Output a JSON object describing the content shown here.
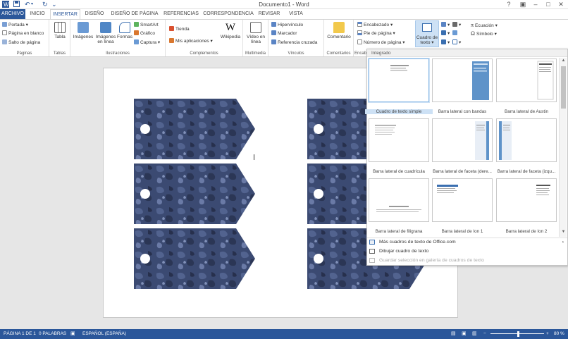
{
  "window": {
    "title": "Documento1 - Word",
    "minimize": "–",
    "maximize": "□",
    "close": "✕",
    "help": "?",
    "ribbon_opts": "▣"
  },
  "qat": {
    "undo": "↶",
    "redo": "↻",
    "more": "⌄"
  },
  "tabs": [
    "ARCHIVO",
    "INICIO",
    "INSERTAR",
    "DISEÑO",
    "DISEÑO DE PÁGINA",
    "REFERENCIAS",
    "CORRESPONDENCIA",
    "REVISAR",
    "VISTA"
  ],
  "active_tab": "INSERTAR",
  "ribbon": {
    "paginas": {
      "label": "Páginas",
      "portada": "Portada ▾",
      "pagina_blanco": "Página en blanco",
      "salto": "Salto de página"
    },
    "tablas": {
      "label": "Tablas",
      "tabla": "Tabla"
    },
    "ilustraciones": {
      "label": "Ilustraciones",
      "imagenes": "Imágenes",
      "imagenes_linea": "Imágenes en línea",
      "formas": "Formas",
      "smartart": "SmartArt",
      "grafico": "Gráfico",
      "captura": "Captura ▾"
    },
    "complementos": {
      "label": "Complementos",
      "tienda": "Tienda",
      "mis_aplicaciones": "Mis aplicaciones ▾",
      "wikipedia": "Wikipedia"
    },
    "multimedia": {
      "label": "Multimedia",
      "video": "Vídeo en línea"
    },
    "vinculos": {
      "label": "Vínculos",
      "hipervinculo": "Hipervínculo",
      "marcador": "Marcador",
      "referencia": "Referencia cruzada"
    },
    "comentarios": {
      "label": "Comentarios",
      "comentario": "Comentario"
    },
    "encabezado": {
      "label": "Encab",
      "encabezado": "Encabezado ▾",
      "pie": "Pie de página ▾",
      "numero": "Número de página ▾"
    },
    "texto": {
      "cuadro": "Cuadro de texto ▾"
    },
    "simbolos": {
      "ecuacion": "Ecuación ▾",
      "simbolo": "Símbolo ▾"
    }
  },
  "gallery": {
    "header": "Integrado",
    "items": [
      "Cuadro de texto simple",
      "Barra lateral con bandas",
      "Barra lateral de Austin",
      "Barra lateral de cuadrícula",
      "Barra lateral de faceta (dere...",
      "Barra lateral de faceta (izqu...",
      "Barra lateral de filigrana",
      "Barra lateral de Ion 1",
      "Barra lateral de Ion 2"
    ],
    "more": "Más cuadros de texto de Office.com",
    "draw": "Dibujar cuadro de texto",
    "save": "Guardar selección en galería de cuadros de texto",
    "arrow": "›",
    "scroll_up": "▲",
    "scroll_down": "▼"
  },
  "status": {
    "page": "PÁGINA 1 DE 1",
    "words": "0 PALABRAS",
    "language": "ESPAÑOL (ESPAÑA)",
    "zoom": "80 %",
    "zoom_minus": "−",
    "zoom_plus": "+"
  },
  "colors": {
    "accent": "#2b579a",
    "tag_fill": "#3b4a72"
  }
}
